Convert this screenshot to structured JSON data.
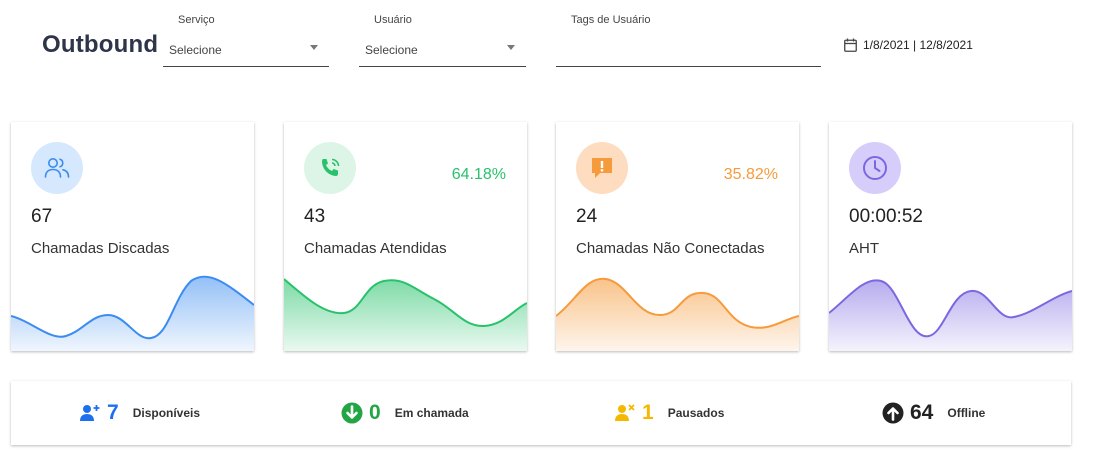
{
  "header": {
    "title": "Outbound",
    "date_range": "1/8/2021 | 12/8/2021"
  },
  "filters": {
    "servico": {
      "label": "Serviço",
      "value": "Selecione"
    },
    "usuario": {
      "label": "Usuário",
      "value": "Selecione"
    },
    "tags": {
      "label": "Tags de Usuário",
      "value": ""
    }
  },
  "cards": [
    {
      "value": "67",
      "label": "Chamadas Discadas",
      "percent": "",
      "icon": "users-icon",
      "color": "#3b8cf0",
      "bg": "#d6e8fd"
    },
    {
      "value": "43",
      "label": "Chamadas Atendidas",
      "percent": "64.18%",
      "icon": "phone-call-icon",
      "color": "#27c26b",
      "bg": "#dcf5e7"
    },
    {
      "value": "24",
      "label": "Chamadas Não Conectadas",
      "percent": "35.82%",
      "icon": "alert-message-icon",
      "color": "#f59b3c",
      "bg": "#fddcbf"
    },
    {
      "value": "00:00:52",
      "label": "AHT",
      "percent": "",
      "icon": "clock-icon",
      "color": "#7b68e0",
      "bg": "#d7cdfa"
    }
  ],
  "status": [
    {
      "count": "7",
      "label": "Disponíveis",
      "icon": "user-plus-icon",
      "color": "#1e6ff0"
    },
    {
      "count": "0",
      "label": "Em chamada",
      "icon": "arrow-down-circle-icon",
      "color": "#23a545"
    },
    {
      "count": "1",
      "label": "Pausados",
      "icon": "user-x-icon",
      "color": "#f5b800"
    },
    {
      "count": "64",
      "label": "Offline",
      "icon": "arrow-up-circle-icon",
      "color": "#222222"
    }
  ]
}
